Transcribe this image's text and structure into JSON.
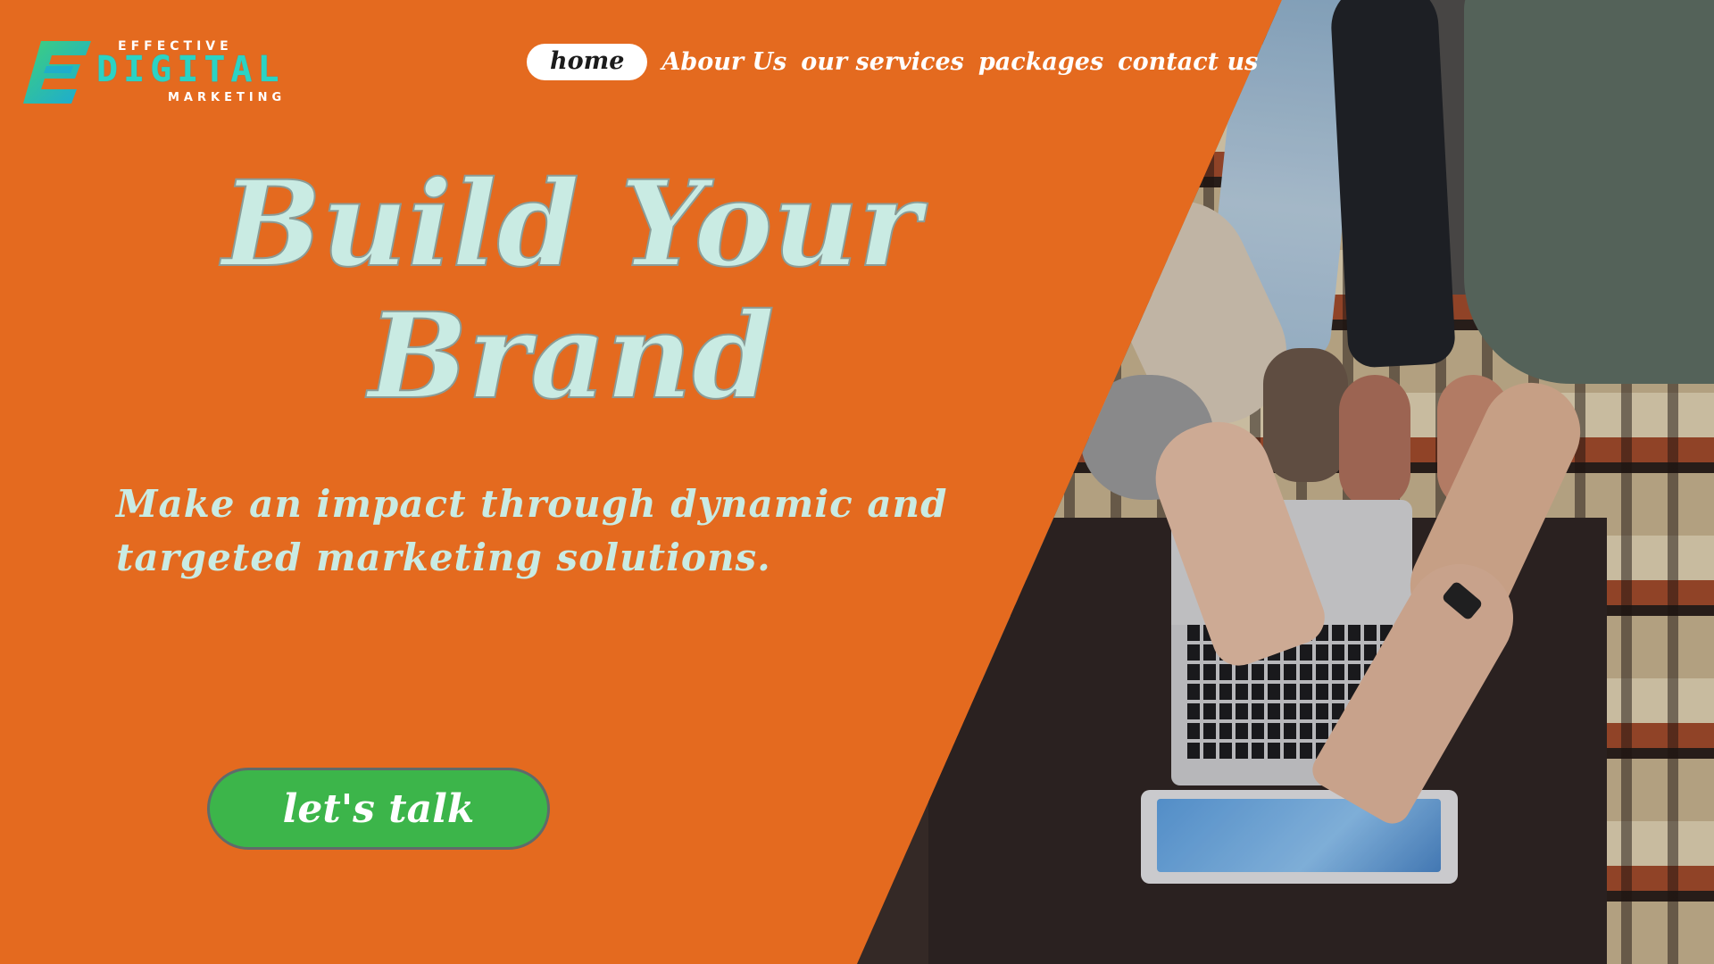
{
  "logo": {
    "top_text": "EFFECTIVE",
    "main_text": "DIGITAL",
    "bottom_text": "MARKETING",
    "colors": {
      "mark_green": "#3fd17a",
      "mark_blue": "#1aa8d8",
      "text_teal": "#2bd3c4"
    }
  },
  "nav": {
    "items": [
      {
        "label": "home",
        "active": true
      },
      {
        "label": "Abour Us",
        "active": false
      },
      {
        "label": "our services",
        "active": false
      },
      {
        "label": "packages",
        "active": false
      },
      {
        "label": "contact us",
        "active": false
      }
    ]
  },
  "hero": {
    "title_line1": "Build Your",
    "title_line2": "Brand",
    "subtitle_line1": "Make an impact through dynamic and",
    "subtitle_line2": "targeted marketing solutions.",
    "cta_label": "let's talk"
  },
  "colors": {
    "background": "#e46a1f",
    "headline": "#c9ebe3",
    "cta_background": "#3cb54a",
    "nav_active_background": "#ffffff"
  }
}
